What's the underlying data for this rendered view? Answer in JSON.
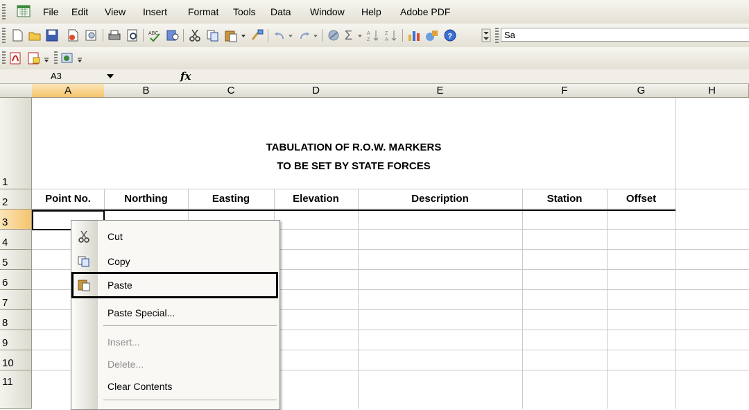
{
  "menubar": {
    "items": [
      "File",
      "Edit",
      "View",
      "Insert",
      "Format",
      "Tools",
      "Data",
      "Window",
      "Help",
      "Adobe PDF"
    ]
  },
  "toolbar": {
    "icons": [
      "new-icon",
      "open-icon",
      "save-icon",
      "permission-icon",
      "print-preview-icon",
      "print-icon",
      "print-preview-page-icon",
      "spelling-icon",
      "research-icon",
      "cut-icon",
      "copy-icon",
      "paste-icon",
      "format-painter-icon",
      "undo-icon",
      "redo-icon",
      "hyperlink-icon",
      "autosum-icon",
      "sort-ascending-icon",
      "sort-descending-icon",
      "chart-wizard-icon",
      "drawing-icon",
      "help-icon"
    ],
    "search_fragment": "Sa"
  },
  "formula_bar": {
    "name_box": "A3",
    "fx_label": "fx",
    "formula": ""
  },
  "columns": [
    "A",
    "B",
    "C",
    "D",
    "E",
    "F",
    "G",
    "H"
  ],
  "rows": [
    "1",
    "2",
    "3",
    "4",
    "5",
    "6",
    "7",
    "8",
    "9",
    "10",
    "11"
  ],
  "sheet": {
    "title_line1": "TABULATION OF R.O.W. MARKERS",
    "title_line2": "TO BE SET BY STATE FORCES",
    "headers": [
      "Point No.",
      "Northing",
      "Easting",
      "Elevation",
      "Description",
      "Station",
      "Offset"
    ]
  },
  "context_menu": {
    "items": [
      {
        "label": "Cut",
        "icon": "scissors-icon",
        "disabled": false
      },
      {
        "label": "Copy",
        "icon": "copy-icon",
        "disabled": false
      },
      {
        "label": "Paste",
        "icon": "clipboard-paste-icon",
        "disabled": false,
        "highlighted": true
      },
      {
        "label": "Paste Special...",
        "icon": "",
        "disabled": false
      },
      {
        "label": "Insert...",
        "icon": "",
        "disabled": true
      },
      {
        "label": "Delete...",
        "icon": "",
        "disabled": true
      },
      {
        "label": "Clear Contents",
        "icon": "",
        "disabled": false
      }
    ]
  },
  "colors": {
    "selected_header": "#f5c46d",
    "disabled_text": "#8d8d8d"
  }
}
